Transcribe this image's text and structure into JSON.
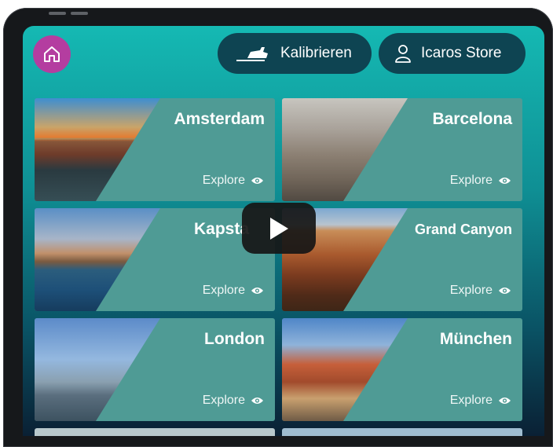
{
  "header": {
    "home_icon": "home-icon",
    "calibrate_label": "Kalibrieren",
    "calibrate_icon": "calibration-device-icon",
    "store_label": "Icaros Store",
    "store_icon": "user-icon"
  },
  "destinations": [
    {
      "city": "Amsterdam",
      "action": "Explore",
      "icon": "eye-icon"
    },
    {
      "city": "Barcelona",
      "action": "Explore",
      "icon": "eye-icon"
    },
    {
      "city": "Kapsta",
      "action": "Explore",
      "icon": "eye-icon"
    },
    {
      "city": "Grand Canyon",
      "action": "Explore",
      "icon": "eye-icon"
    },
    {
      "city": "London",
      "action": "Explore",
      "icon": "eye-icon"
    },
    {
      "city": "München",
      "action": "Explore",
      "icon": "eye-icon"
    }
  ],
  "video": {
    "play_icon": "play-icon"
  },
  "colors": {
    "home_button": "#b43da0",
    "pill": "#0e4452",
    "card": "#4f9b95",
    "screen_top": "#15b9b3"
  }
}
